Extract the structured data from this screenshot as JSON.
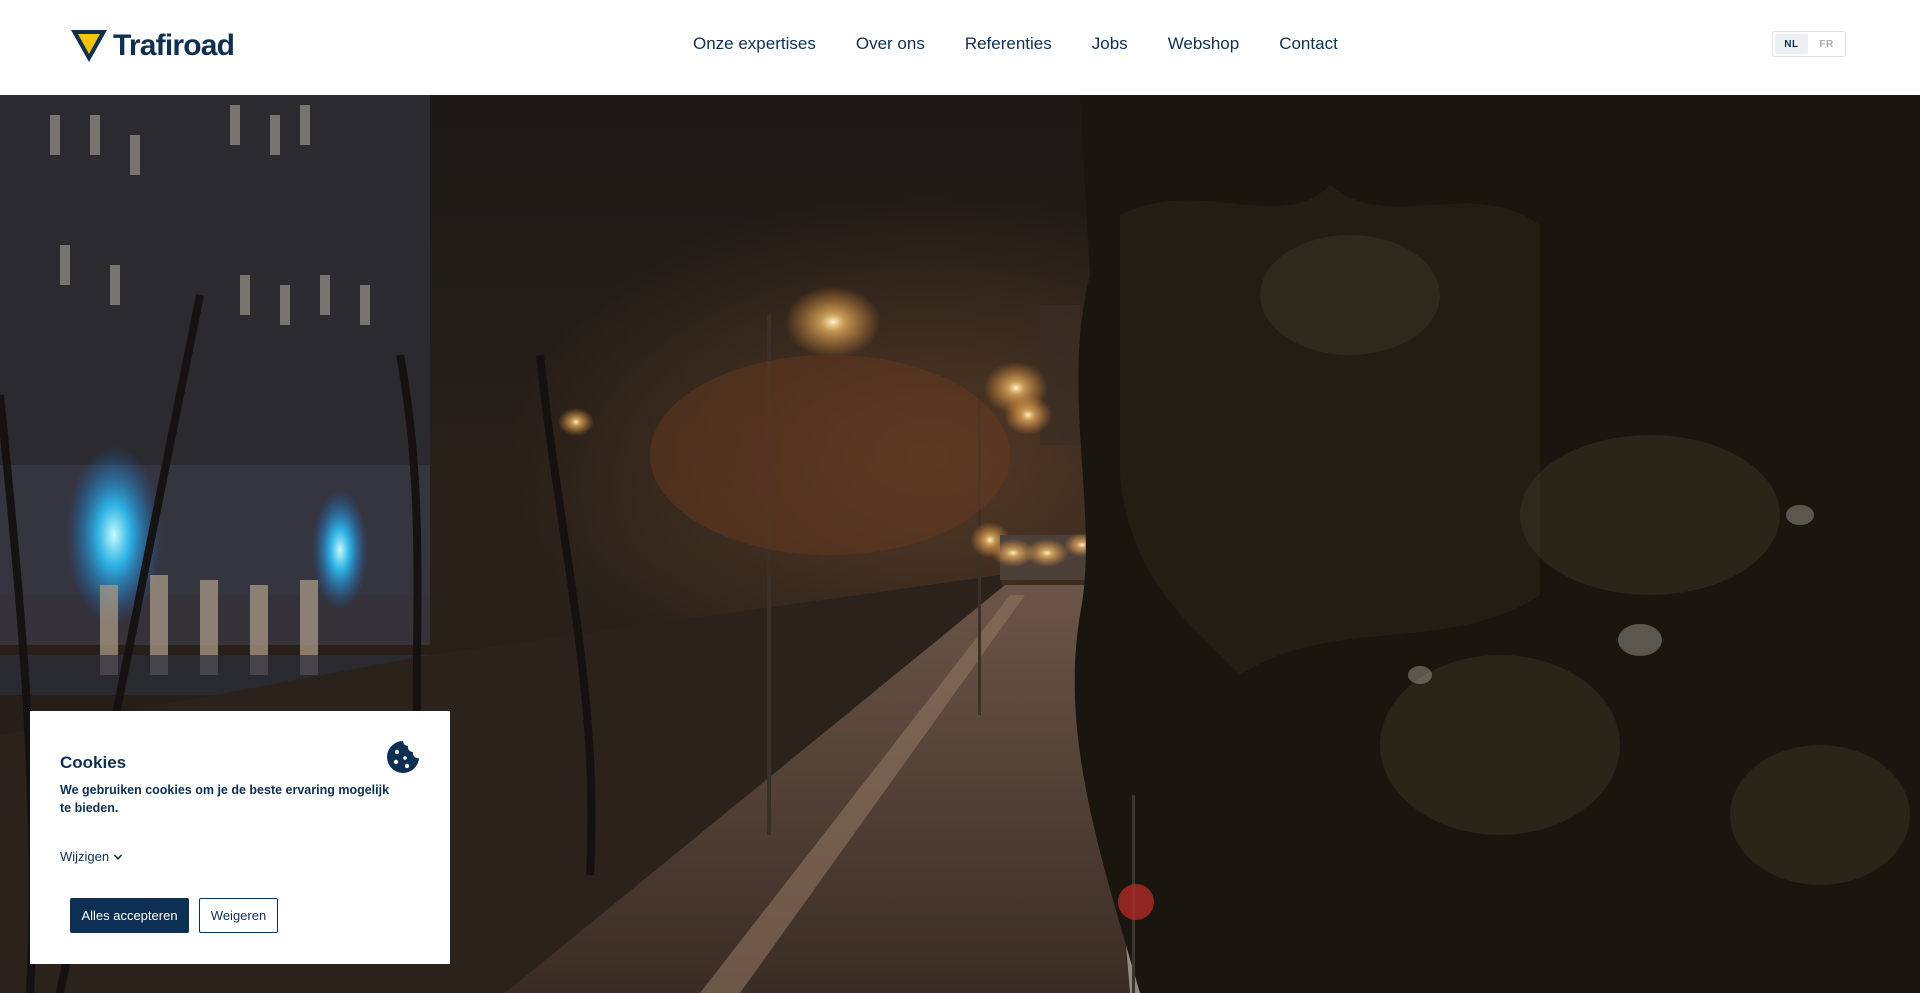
{
  "brand": {
    "name": "Trafiroad",
    "primary_color": "#0e2f54",
    "accent_color": "#f5c400"
  },
  "nav": {
    "items": [
      {
        "label": "Onze expertises"
      },
      {
        "label": "Over ons"
      },
      {
        "label": "Referenties"
      },
      {
        "label": "Jobs"
      },
      {
        "label": "Webshop"
      },
      {
        "label": "Contact"
      }
    ]
  },
  "language": {
    "options": [
      "NL",
      "FR"
    ],
    "selected": "NL"
  },
  "cookie_banner": {
    "title": "Cookies",
    "icon": "cookie-icon",
    "text": "We gebruiken cookies om je de beste ervaring mogelijk te bieden.",
    "change_label": "Wijzigen",
    "accept_label": "Alles accepteren",
    "reject_label": "Weigeren"
  }
}
